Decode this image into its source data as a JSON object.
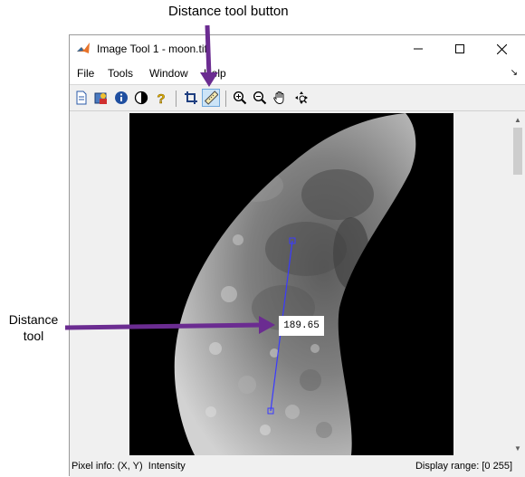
{
  "callouts": {
    "distance_tool_button": "Distance tool button",
    "distance_tool_line1": "Distance",
    "distance_tool_line2": "tool"
  },
  "window": {
    "title": "Image Tool 1 - moon.tif",
    "icons": {
      "app": "matlab-icon",
      "minimize": "minimize-icon",
      "maximize": "maximize-icon",
      "close": "close-icon"
    }
  },
  "menubar": {
    "items": [
      "File",
      "Tools",
      "Window",
      "Help"
    ],
    "dock_arrow": "↘"
  },
  "toolbar": {
    "buttons": [
      "new-figure-icon",
      "image-info-icon",
      "info-icon",
      "contrast-icon",
      "help-icon",
      "crop-icon",
      "distance-tool-icon",
      "zoom-in-icon",
      "zoom-out-icon",
      "pan-hand-icon",
      "overview-icon"
    ],
    "active": "distance-tool-icon"
  },
  "image": {
    "distance_value": "189.65"
  },
  "statusbar": {
    "pixel_info_label": "Pixel info:",
    "pixel_info_value": "(X, Y)  Intensity",
    "display_range_label": "Display range:",
    "display_range_value": "[0 255]"
  },
  "colors": {
    "accent": "#6b2c91",
    "measure_line": "#3a3aff",
    "active_button": "#cce4f7"
  }
}
